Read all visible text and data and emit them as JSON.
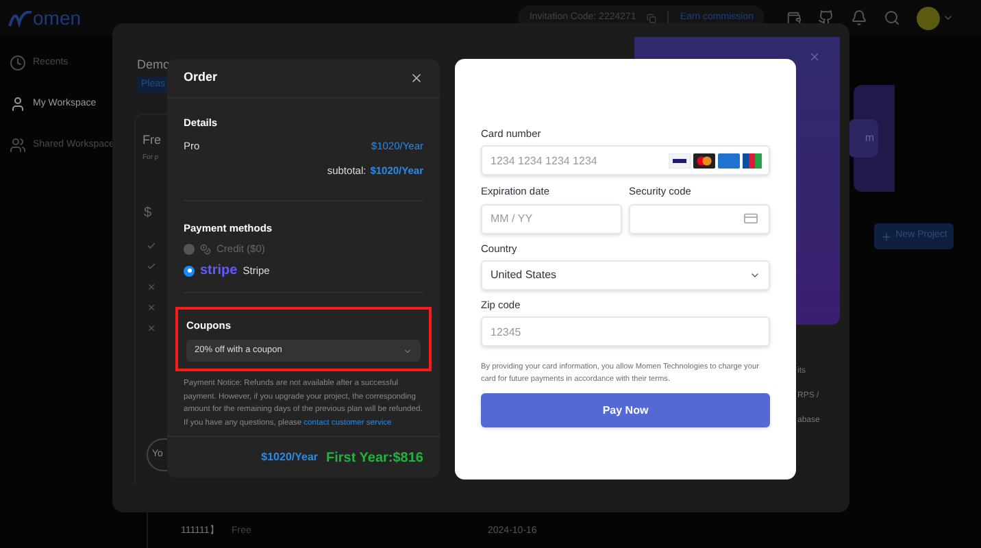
{
  "header": {
    "logo": "omen",
    "invitation_code": "Invitation Code: 2224271",
    "earn": "Earn commission"
  },
  "sidebar": {
    "items": [
      {
        "label": "Recents",
        "selected": false
      },
      {
        "label": "My Workspace",
        "selected": true
      },
      {
        "label": "Shared Workspace",
        "selected": false
      }
    ]
  },
  "page": {
    "new_project": "New Project",
    "purple_button": "m",
    "row": {
      "name": "111111】",
      "plan": "Free",
      "date": "2024-10-16"
    }
  },
  "plan_dialog": {
    "title": "Demo",
    "badge": "Pleas",
    "card_title": "Fre",
    "card_subtitle": "For p",
    "currency": "$",
    "features": [
      {
        "kind": "check"
      },
      {
        "kind": "check"
      },
      {
        "kind": "cross"
      },
      {
        "kind": "cross"
      },
      {
        "kind": "cross"
      }
    ],
    "button": "Yo",
    "panel_texts": [
      "its",
      "RPS /",
      "abase"
    ]
  },
  "order": {
    "title": "Order",
    "details_title": "Details",
    "item": "Pro",
    "item_price": "$1020/Year",
    "subtotal_label": "subtotal:",
    "subtotal": "$1020/Year",
    "payment_title": "Payment methods",
    "methods": [
      {
        "kind": "credit",
        "label": "Credit ($0)",
        "selected": false,
        "disabled": true
      },
      {
        "kind": "stripe",
        "logo": "stripe",
        "label": "Stripe",
        "selected": true,
        "disabled": false
      }
    ],
    "coupons": {
      "title": "Coupons",
      "value": "20% off with a coupon",
      "highlighted": true
    },
    "notice": "Payment Notice: Refunds are not available after a successful payment. However, if you upgrade your project, the corresponding amount for the remaining days of the previous plan will be refunded.",
    "question": "If you have any questions, please ",
    "link": "contact customer service",
    "price": "$1020/Year",
    "first_year": "First Year:$816"
  },
  "card_form": {
    "card_label": "Card number",
    "card_placeholder": "1234 1234 1234 1234",
    "expiry_label": "Expiration date",
    "expiry_placeholder": "MM / YY",
    "cvc_label": "Security code",
    "country_label": "Country",
    "country": "United States",
    "zip_label": "Zip code",
    "zip_placeholder": "12345",
    "terms": "By providing your card information, you allow Momen Technologies to charge your card for future payments in accordance with their terms.",
    "pay": "Pay Now"
  }
}
